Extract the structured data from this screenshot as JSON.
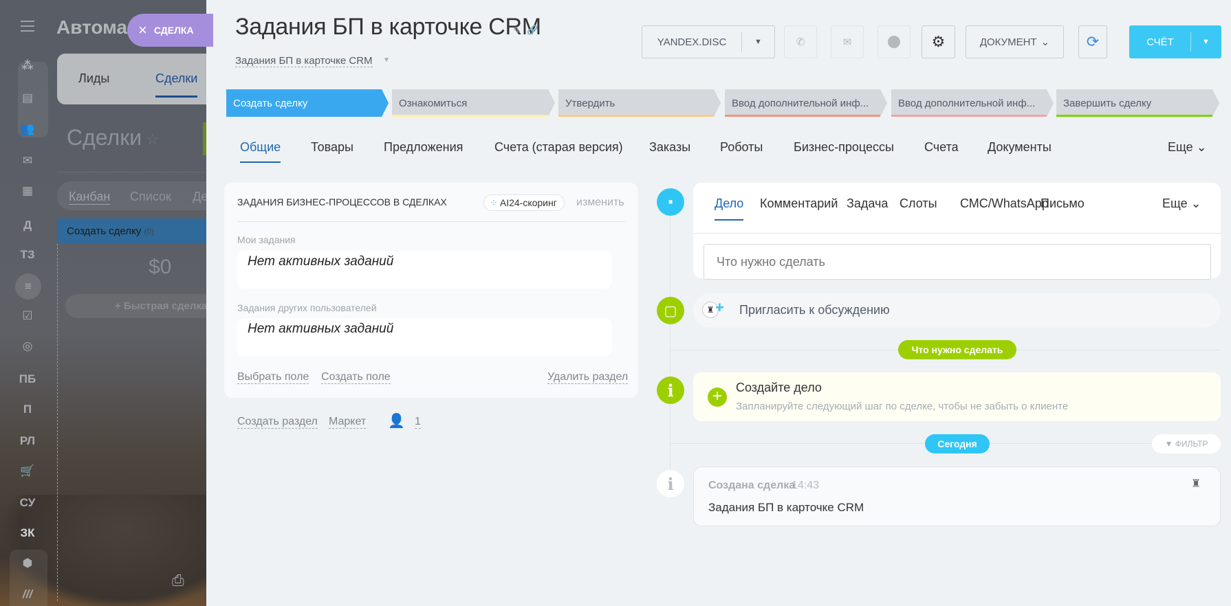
{
  "background_app": {
    "title": "Автома",
    "tabs": [
      "Лиды",
      "Сделки"
    ],
    "heading": "Сделки",
    "views": [
      "Канбан",
      "Список",
      "Де"
    ],
    "column": {
      "name": "Создать сделку",
      "count": "(0)",
      "sum": "$0"
    },
    "quick_deal": "+ Быстрая сделка",
    "sidebar_letters": [
      "Д",
      "ТЗ",
      "ПБ",
      "П",
      "РЛ",
      "СУ",
      "ЗК"
    ],
    "close_tag": "СДЕЛКА"
  },
  "header": {
    "title": "Задания БП в карточке CRM",
    "category": "Задания БП в карточке CRM"
  },
  "toolbar": {
    "yandex": "YANDEX.DISC",
    "document": "ДОКУМЕНТ",
    "invoice": "СЧЁТ"
  },
  "stages": [
    {
      "label": "Создать сделку",
      "color": "#39a8ef",
      "active": true
    },
    {
      "label": "Ознакомиться",
      "color": "#fff0a8"
    },
    {
      "label": "Утвердить",
      "color": "#fcc98a"
    },
    {
      "label": "Ввод дополнительной инф...",
      "color": "#f39580"
    },
    {
      "label": "Ввод дополнительной инф...",
      "color": "#f3a3a3"
    },
    {
      "label": "Завершить сделку",
      "color": "#7bd500"
    }
  ],
  "tabs": [
    "Общие",
    "Товары",
    "Предложения",
    "Счета (старая версия)",
    "Заказы",
    "Роботы",
    "Бизнес-процессы",
    "Счета",
    "Документы",
    "Еще"
  ],
  "bp_section": {
    "title": "ЗАДАНИЯ БИЗНЕС-ПРОЦЕССОВ В СДЕЛКАХ",
    "badge": "AI24-скоринг",
    "edit": "изменить",
    "my_tasks_label": "Мои задания",
    "my_tasks_value": "Нет активных заданий",
    "others_label": "Задания других пользователей",
    "others_value": "Нет активных заданий",
    "select_field": "Выбрать поле",
    "create_field": "Создать поле",
    "delete_section": "Удалить раздел"
  },
  "below_section": {
    "create_section": "Создать раздел",
    "market": "Маркет",
    "users_count": "1"
  },
  "activity": {
    "tabs": [
      "Дело",
      "Комментарий",
      "Задача",
      "Слоты",
      "СМС/WhatsApp",
      "Письмо",
      "Еще"
    ],
    "input_placeholder": "Что нужно сделать",
    "invite": "Пригласить к обсуждению",
    "todo_pill": "Что нужно сделать",
    "create_title": "Создайте дело",
    "create_hint": "Запланируйте следующий шаг по сделке, чтобы не забыть о клиенте",
    "today_pill": "Сегодня",
    "filter": "ФИЛЬТР",
    "history": {
      "title": "Создана сделка",
      "time": "14:43",
      "text": "Задания БП в карточке CRM"
    }
  },
  "colors": {
    "accent": "#2fc6f6",
    "primary_blue": "#2067b0",
    "green": "#9dcf00",
    "stage_active": "#39a8ef"
  }
}
